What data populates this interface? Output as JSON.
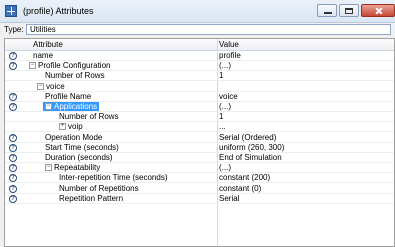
{
  "window": {
    "title": "(profile) Attributes",
    "close_color": "#c74835"
  },
  "type_field": {
    "label": "Type:",
    "value": "Utilities"
  },
  "grid": {
    "headers": {
      "attribute": "Attribute",
      "value": "Value"
    },
    "rows": [
      {
        "attr": "name",
        "value": "profile",
        "help": true,
        "expander": "",
        "selected": false
      },
      {
        "attr": "Profile Configuration",
        "value": "(...)",
        "help": true,
        "expander": "minus",
        "selected": false
      },
      {
        "attr": "Number of Rows",
        "value": "1",
        "help": false,
        "expander": "",
        "selected": false
      },
      {
        "attr": "voice",
        "value": "",
        "help": false,
        "expander": "minus",
        "selected": false
      },
      {
        "attr": "Profile Name",
        "value": "voice",
        "help": true,
        "expander": "",
        "selected": false
      },
      {
        "attr": "Applications",
        "value": "(...)",
        "help": true,
        "expander": "minus",
        "selected": true
      },
      {
        "attr": "Number of Rows",
        "value": "1",
        "help": false,
        "expander": "",
        "selected": false
      },
      {
        "attr": "voip",
        "value": "...",
        "help": false,
        "expander": "plus",
        "selected": false
      },
      {
        "attr": "Operation Mode",
        "value": "Serial (Ordered)",
        "help": true,
        "expander": "",
        "selected": false
      },
      {
        "attr": "Start Time (seconds)",
        "value": "uniform (260, 300)",
        "help": true,
        "expander": "",
        "selected": false
      },
      {
        "attr": "Duration (seconds)",
        "value": "End of Simulation",
        "help": true,
        "expander": "",
        "selected": false
      },
      {
        "attr": "Repeatability",
        "value": "(...)",
        "help": true,
        "expander": "minus",
        "selected": false
      },
      {
        "attr": "Inter-repetition Time (seconds)",
        "value": "constant (200)",
        "help": true,
        "expander": "",
        "selected": false
      },
      {
        "attr": "Number of Repetitions",
        "value": "constant (0)",
        "help": true,
        "expander": "",
        "selected": false
      },
      {
        "attr": "Repetition Pattern",
        "value": "Serial",
        "help": true,
        "expander": "",
        "selected": false
      }
    ],
    "help_glyph": "?",
    "selection_color": "#3399ff"
  }
}
